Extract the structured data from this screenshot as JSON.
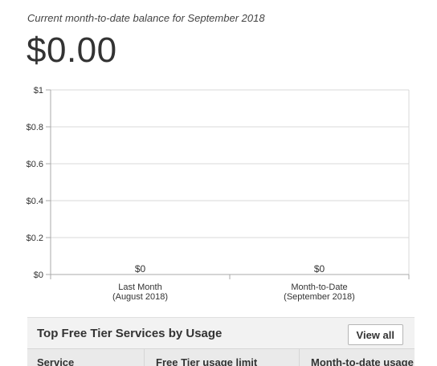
{
  "header": {
    "subtitle": "Current month-to-date balance for September 2018",
    "balance": "$0.00"
  },
  "chart_data": {
    "type": "bar",
    "categories": [
      [
        "Last Month",
        "(August 2018)"
      ],
      [
        "Month-to-Date",
        "(September 2018)"
      ]
    ],
    "values": [
      0,
      0
    ],
    "data_labels": [
      "$0",
      "$0"
    ],
    "ylim": [
      0,
      1
    ],
    "yticks": [
      0,
      0.2,
      0.4,
      0.6,
      0.8,
      1
    ],
    "ytick_labels": [
      "$0",
      "$0.2",
      "$0.4",
      "$0.6",
      "$0.8",
      "$1"
    ],
    "grid": true,
    "gridline_color": "#d9d9d9",
    "axis_color": "#aaaaaa"
  },
  "free_tier": {
    "title": "Top Free Tier Services by Usage",
    "view_all_label": "View all",
    "columns": [
      "Service",
      "Free Tier usage limit",
      "Month-to-date usage"
    ]
  }
}
